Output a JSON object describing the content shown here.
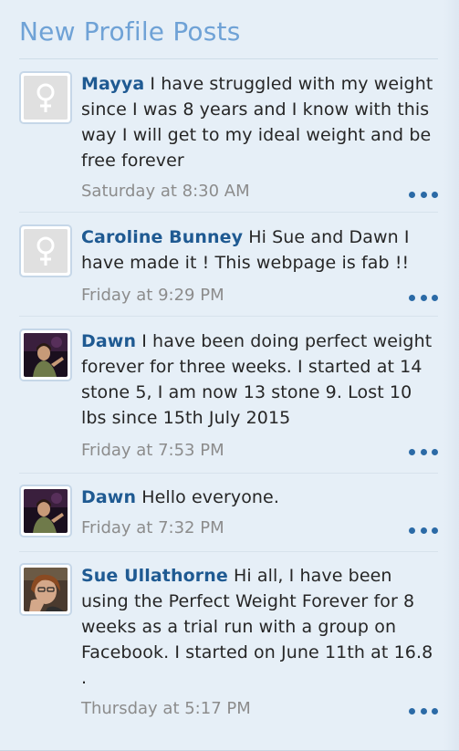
{
  "widget": {
    "title": "New Profile Posts"
  },
  "posts": [
    {
      "author": "Mayya",
      "message": " I have struggled with my weight since I was 8 years and I know with this way I will get to my ideal weight and be free forever",
      "time": "Saturday at 8:30 AM",
      "avatar": "default-female-avatar"
    },
    {
      "author": "Caroline Bunney",
      "message": " Hi Sue and Dawn I have made it ! This webpage is fab !!",
      "time": "Friday at 9:29 PM",
      "avatar": "default-female-avatar"
    },
    {
      "author": "Dawn",
      "message": " I have been doing perfect weight forever for three weeks. I started at 14 stone 5, I am now 13 stone 9. Lost 10 lbs since 15th July 2015",
      "time": "Friday at 7:53 PM",
      "avatar": "photo-avatar-dawn"
    },
    {
      "author": "Dawn",
      "message": " Hello everyone.",
      "time": "Friday at 7:32 PM",
      "avatar": "photo-avatar-dawn"
    },
    {
      "author": "Sue Ullathorne",
      "message": " Hi all, I have been using the Perfect Weight Forever for 8 weeks as a trial run with a group on Facebook. I started on June 11th at 16.8 .",
      "time": "Thursday at 5:17 PM",
      "avatar": "photo-avatar-sue"
    }
  ],
  "colors": {
    "title": "#6fa2d6",
    "author": "#1f5a92",
    "time": "#8c8c8c",
    "background": "#e6eff7",
    "more_dots": "#2b6aa6"
  }
}
